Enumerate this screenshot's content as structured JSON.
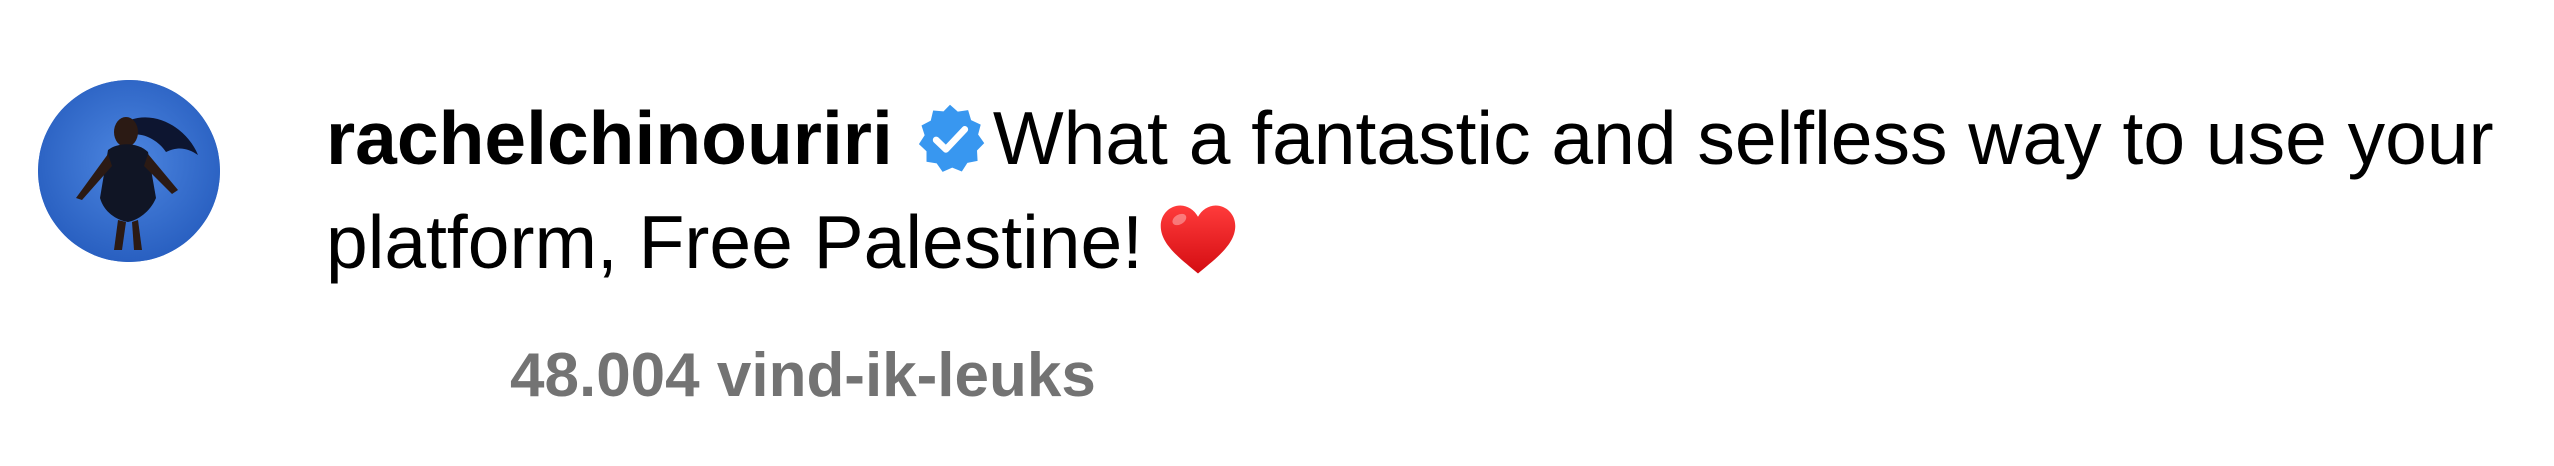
{
  "comment": {
    "username": "rachelchinouriri",
    "verified_icon": "verified-badge-icon",
    "text": "What a fantastic and selfless way to use your platform, Free Palestine!",
    "emoji": "red-heart",
    "likes_label": "48.004 vind-ik-leuks"
  },
  "colors": {
    "verified_badge": "#3897f0",
    "likes_text": "#737373",
    "heart": "#e0101d",
    "avatar_background": "#2a66c9"
  }
}
